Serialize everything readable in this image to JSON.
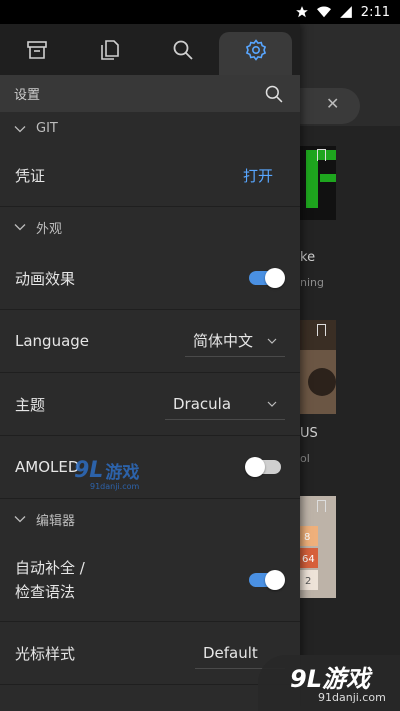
{
  "status_bar": {
    "time": "2:11"
  },
  "drawer": {
    "tabs": [
      {
        "icon": "archive-icon",
        "active": false
      },
      {
        "icon": "files-icon",
        "active": false
      },
      {
        "icon": "search-icon",
        "active": false
      },
      {
        "icon": "gear-icon",
        "active": true
      }
    ],
    "header": {
      "label": "设置"
    },
    "sections": {
      "git": {
        "title": "GIT"
      },
      "appearance": {
        "title": "外观"
      },
      "editor": {
        "title": "编辑器"
      }
    },
    "rows": {
      "credentials": {
        "label": "凭证",
        "action": "打开"
      },
      "animations": {
        "label": "动画效果",
        "on": true
      },
      "language": {
        "label": "Language",
        "value": "简体中文"
      },
      "theme": {
        "label": "主题",
        "value": "Dracula"
      },
      "amoled": {
        "label": "AMOLED",
        "on": false
      },
      "autocomplete": {
        "label_line1": "自动补全 /",
        "label_line2": "检查语法",
        "on": true
      },
      "cursor_style": {
        "label": "光标样式",
        "value": "Default"
      }
    }
  },
  "background": {
    "card1": {
      "title": "ke",
      "subtitle": "ning"
    },
    "card2": {
      "title": "US",
      "subtitle": "ol"
    },
    "card3": {
      "tiles": [
        "8",
        "64",
        "2"
      ]
    }
  },
  "watermark": {
    "mark": "9L",
    "cn": "游戏",
    "url": "91danji.com"
  },
  "corner_logo": {
    "text": "9L游戏",
    "url": "91danji.com"
  },
  "colors": {
    "accent": "#58a6ff",
    "toggle_on": "#4a90e2",
    "drawer_bg": "#2b2b2b"
  }
}
